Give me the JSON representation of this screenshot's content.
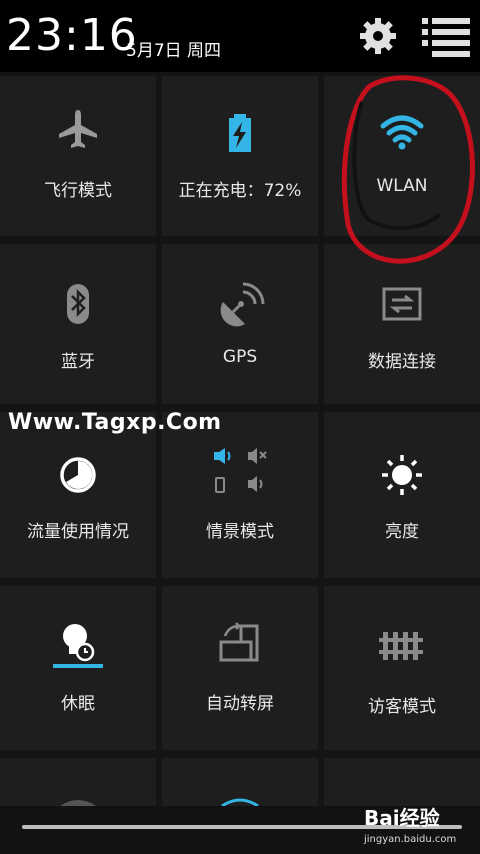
{
  "status": {
    "time": "23:16",
    "date": "5月7日 周四"
  },
  "tiles": [
    {
      "label": "飞行模式",
      "icon": "airplane-icon"
    },
    {
      "label": "正在充电：72%",
      "icon": "battery-charging-icon"
    },
    {
      "label": "WLAN",
      "icon": "wifi-icon",
      "active_color": "#33b5e5"
    },
    {
      "label": "蓝牙",
      "icon": "bluetooth-icon"
    },
    {
      "label": "GPS",
      "icon": "gps-satellite-icon"
    },
    {
      "label": "数据连接",
      "icon": "data-connection-icon"
    },
    {
      "label": "流量使用情况",
      "icon": "data-usage-icon"
    },
    {
      "label": "情景模式",
      "icon": "sound-profile-icon"
    },
    {
      "label": "亮度",
      "icon": "brightness-icon"
    },
    {
      "label": "休眠",
      "icon": "sleep-icon"
    },
    {
      "label": "自动转屏",
      "icon": "auto-rotate-icon"
    },
    {
      "label": "访客模式",
      "icon": "guest-mode-icon"
    }
  ],
  "overlay": {
    "watermark": "Www.Tagxp.Com",
    "baidu_brand": "Bai经验",
    "baidu_url": "jingyan.baidu.com"
  },
  "colors": {
    "accent": "#33b5e5",
    "annotation": "#c4101c"
  }
}
